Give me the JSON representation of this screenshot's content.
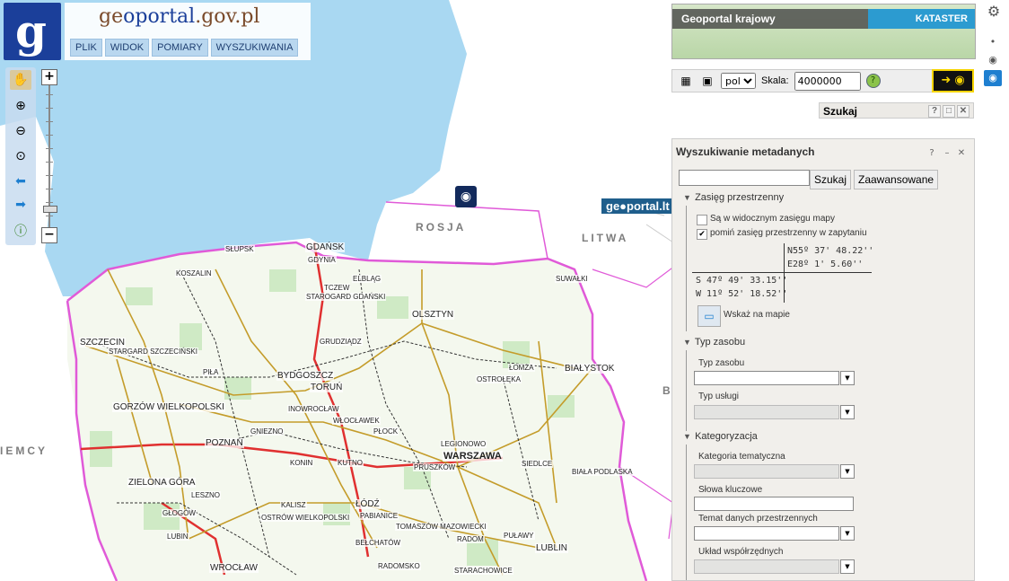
{
  "brand": {
    "logo_letter": "g",
    "site_prefix": "ge",
    "site_mid": "oportal",
    "site_suffix": ".gov.pl"
  },
  "menu": [
    "PLIK",
    "WIDOK",
    "POMIARY",
    "WYSZUKIWANIA"
  ],
  "map_labels": {
    "russia": "ROSJA",
    "lithuania": "LITWA",
    "germany": "IEMCY",
    "belarus": "B"
  },
  "cities": [
    {
      "name": "GDAŃSK",
      "cls": "mid"
    },
    {
      "name": "GDYNIA",
      "cls": ""
    },
    {
      "name": "SŁUPSK",
      "cls": ""
    },
    {
      "name": "KOSZALIN",
      "cls": ""
    },
    {
      "name": "STAROGARD GDAŃSKI",
      "cls": ""
    },
    {
      "name": "ELBLĄG",
      "cls": ""
    },
    {
      "name": "TCZEW",
      "cls": ""
    },
    {
      "name": "OLSZTYN",
      "cls": "mid"
    },
    {
      "name": "SZCZECIN",
      "cls": "mid"
    },
    {
      "name": "STARGARD SZCZECIŃSKI",
      "cls": ""
    },
    {
      "name": "GRUDZIĄDZ",
      "cls": ""
    },
    {
      "name": "SUWAŁKI",
      "cls": ""
    },
    {
      "name": "PIŁA",
      "cls": ""
    },
    {
      "name": "BYDGOSZCZ",
      "cls": "mid"
    },
    {
      "name": "TORUŃ",
      "cls": "mid"
    },
    {
      "name": "ŁOMŻA",
      "cls": ""
    },
    {
      "name": "BIAŁYSTOK",
      "cls": "mid"
    },
    {
      "name": "OSTROŁĘKA",
      "cls": ""
    },
    {
      "name": "GORZÓW WIELKOPOLSKI",
      "cls": "mid"
    },
    {
      "name": "INOWROCŁAW",
      "cls": ""
    },
    {
      "name": "WŁOCŁAWEK",
      "cls": ""
    },
    {
      "name": "PŁOCK",
      "cls": ""
    },
    {
      "name": "GNIEZNO",
      "cls": ""
    },
    {
      "name": "POZNAŃ",
      "cls": "mid"
    },
    {
      "name": "LEGIONOWO",
      "cls": ""
    },
    {
      "name": "WARSZAWA",
      "cls": "big"
    },
    {
      "name": "SIEDLCE",
      "cls": ""
    },
    {
      "name": "PRUSZKÓW",
      "cls": ""
    },
    {
      "name": "KONIN",
      "cls": ""
    },
    {
      "name": "KUTNO",
      "cls": ""
    },
    {
      "name": "BIAŁA PODLASKA",
      "cls": ""
    },
    {
      "name": "ZIELONA GÓRA",
      "cls": "mid"
    },
    {
      "name": "LESZNO",
      "cls": ""
    },
    {
      "name": "ŁÓDŹ",
      "cls": "mid"
    },
    {
      "name": "KALISZ",
      "cls": ""
    },
    {
      "name": "GŁOGÓW",
      "cls": ""
    },
    {
      "name": "OSTRÓW WIELKOPOLSKI",
      "cls": ""
    },
    {
      "name": "PABIANICE",
      "cls": ""
    },
    {
      "name": "TOMASZÓW MAZOWIECKI",
      "cls": ""
    },
    {
      "name": "RADOM",
      "cls": ""
    },
    {
      "name": "PUŁAWY",
      "cls": ""
    },
    {
      "name": "LUBIN",
      "cls": ""
    },
    {
      "name": "BEŁCHATÓW",
      "cls": ""
    },
    {
      "name": "LUBLIN",
      "cls": "mid"
    },
    {
      "name": "WROCŁAW",
      "cls": "mid"
    },
    {
      "name": "RADOMSKO",
      "cls": ""
    },
    {
      "name": "STARACHOWICE",
      "cls": ""
    }
  ],
  "geoportal_badge": "ge●portal.lt",
  "layers": {
    "left": "Geoportal krajowy",
    "right": "KATASTER"
  },
  "toolbar": {
    "lang": "pol",
    "scale_label": "Skala:",
    "scale_value": "4000000",
    "help": "?"
  },
  "szukaj": {
    "title": "Szukaj"
  },
  "meta": {
    "title": "Wyszukiwanie metadanych",
    "search_btn": "Szukaj",
    "advanced_btn": "Zaawansowane",
    "sec_extent": "Zasięg przestrzenny",
    "chk_visible": "Są w widocznym zasięgu mapy",
    "chk_ignore": "pomiń zasięg przestrzenny w zapytaniu",
    "n": "N55º 37' 48.22''",
    "e": "E28º 1' 5.60''",
    "s": "S 47º 49' 33.15''",
    "w": "W 11º 52' 18.52''",
    "show_on_map": "Wskaż na mapie",
    "sec_type": "Typ zasobu",
    "lbl_type": "Typ zasobu",
    "lbl_service": "Typ usługi",
    "sec_cat": "Kategoryzacja",
    "lbl_topic": "Kategoria tematyczna",
    "lbl_keywords": "Słowa kluczowe",
    "lbl_theme": "Temat danych przestrzennych",
    "lbl_crs": "Układ współrzędnych"
  },
  "colors": {
    "sea": "#a9d8f2",
    "land_outside": "#ffffff",
    "border_pl": "#e05ad8",
    "motorway": "#e03030",
    "road": "#c49c2a",
    "accent": "#1e7fd0"
  },
  "icons": [
    "hand-icon",
    "zoom-in-icon",
    "zoom-out-icon",
    "zoom-extent-icon",
    "arrow-left-icon",
    "arrow-right-icon",
    "info-icon",
    "gear-icon",
    "eye-icon"
  ]
}
